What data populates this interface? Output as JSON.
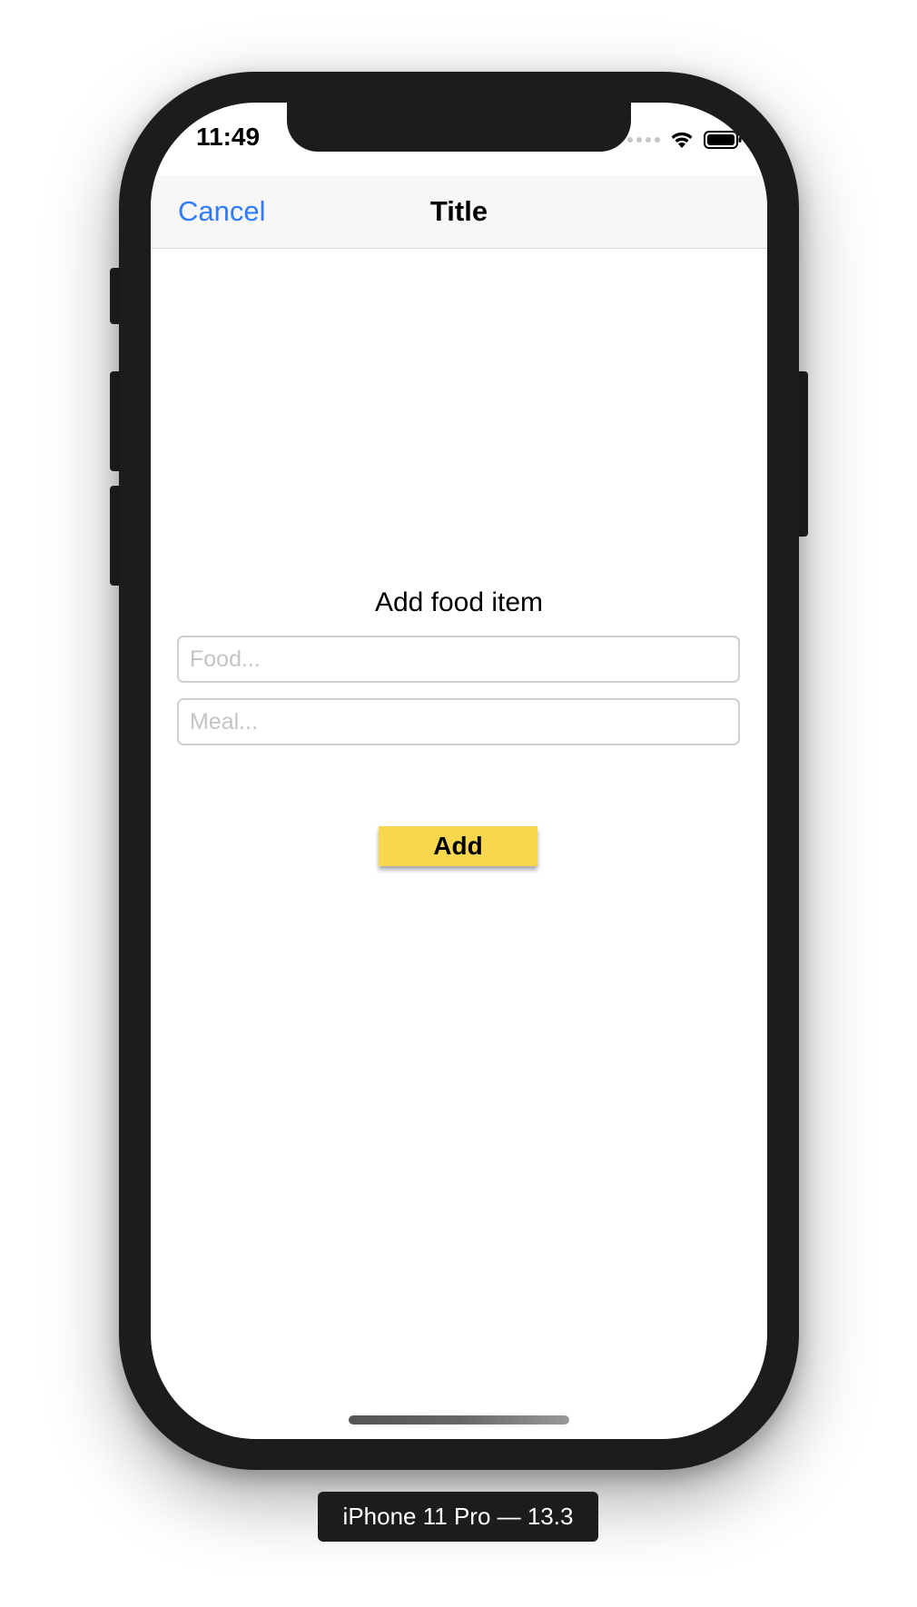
{
  "status_bar": {
    "time": "11:49",
    "icons": [
      "signal-dots-icon",
      "wifi-icon",
      "battery-icon"
    ]
  },
  "navbar": {
    "cancel_label": "Cancel",
    "title": "Title"
  },
  "form": {
    "heading": "Add food item",
    "food_placeholder": "Food...",
    "meal_placeholder": "Meal...",
    "add_label": "Add"
  },
  "device_label": "iPhone 11 Pro — 13.3",
  "colors": {
    "accent_blue": "#2f7cf6",
    "add_button": "#f8d74f",
    "device_frame": "#1c1c1c"
  }
}
